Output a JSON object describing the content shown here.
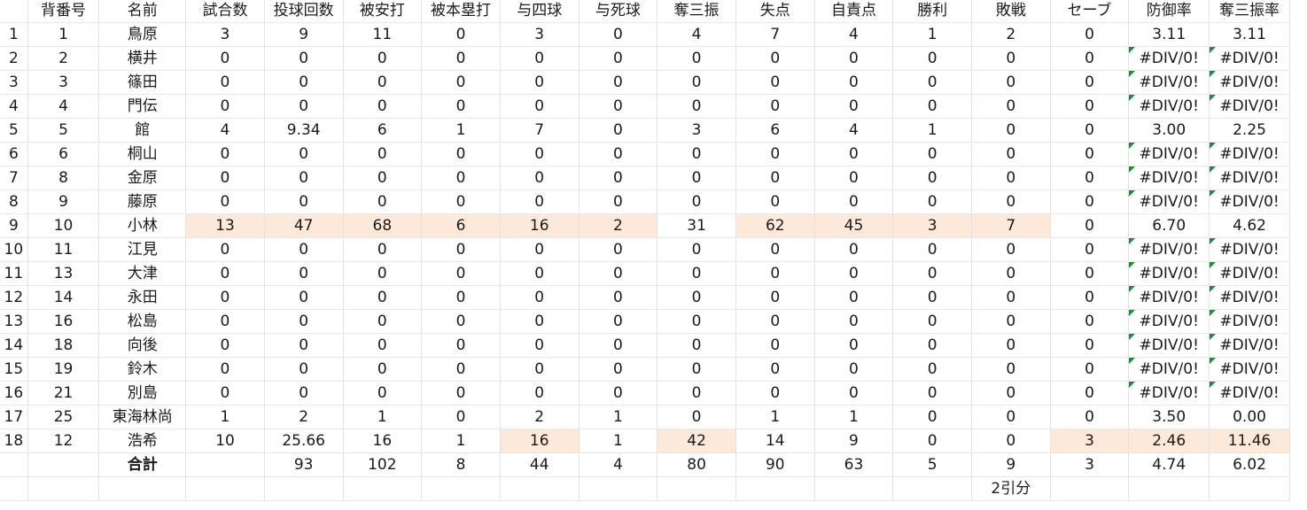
{
  "headers": [
    "",
    "背番号",
    "名前",
    "試合数",
    "投球回数",
    "被安打",
    "被本塁打",
    "与四球",
    "与死球",
    "奪三振",
    "失点",
    "自責点",
    "勝利",
    "敗戦",
    "セーブ",
    "防御率",
    "奪三振率"
  ],
  "rows": [
    [
      "1",
      "1",
      "鳥原",
      "3",
      "9",
      "11",
      "0",
      "3",
      "0",
      "4",
      "7",
      "4",
      "1",
      "2",
      "0",
      "3.11",
      "3.11"
    ],
    [
      "2",
      "2",
      "横井",
      "0",
      "0",
      "0",
      "0",
      "0",
      "0",
      "0",
      "0",
      "0",
      "0",
      "0",
      "0",
      "#DIV/0!",
      "#DIV/0!"
    ],
    [
      "3",
      "3",
      "篠田",
      "0",
      "0",
      "0",
      "0",
      "0",
      "0",
      "0",
      "0",
      "0",
      "0",
      "0",
      "0",
      "#DIV/0!",
      "#DIV/0!"
    ],
    [
      "4",
      "4",
      "門伝",
      "0",
      "0",
      "0",
      "0",
      "0",
      "0",
      "0",
      "0",
      "0",
      "0",
      "0",
      "0",
      "#DIV/0!",
      "#DIV/0!"
    ],
    [
      "5",
      "5",
      "館",
      "4",
      "9.34",
      "6",
      "1",
      "7",
      "0",
      "3",
      "6",
      "4",
      "1",
      "0",
      "0",
      "3.00",
      "2.25"
    ],
    [
      "6",
      "6",
      "桐山",
      "0",
      "0",
      "0",
      "0",
      "0",
      "0",
      "0",
      "0",
      "0",
      "0",
      "0",
      "0",
      "#DIV/0!",
      "#DIV/0!"
    ],
    [
      "7",
      "8",
      "金原",
      "0",
      "0",
      "0",
      "0",
      "0",
      "0",
      "0",
      "0",
      "0",
      "0",
      "0",
      "0",
      "#DIV/0!",
      "#DIV/0!"
    ],
    [
      "8",
      "9",
      "藤原",
      "0",
      "0",
      "0",
      "0",
      "0",
      "0",
      "0",
      "0",
      "0",
      "0",
      "0",
      "0",
      "#DIV/0!",
      "#DIV/0!"
    ],
    [
      "9",
      "10",
      "小林",
      "13",
      "47",
      "68",
      "6",
      "16",
      "2",
      "31",
      "62",
      "45",
      "3",
      "7",
      "0",
      "6.70",
      "4.62"
    ],
    [
      "10",
      "11",
      "江見",
      "0",
      "0",
      "0",
      "0",
      "0",
      "0",
      "0",
      "0",
      "0",
      "0",
      "0",
      "0",
      "#DIV/0!",
      "#DIV/0!"
    ],
    [
      "11",
      "13",
      "大津",
      "0",
      "0",
      "0",
      "0",
      "0",
      "0",
      "0",
      "0",
      "0",
      "0",
      "0",
      "0",
      "#DIV/0!",
      "#DIV/0!"
    ],
    [
      "12",
      "14",
      "永田",
      "0",
      "0",
      "0",
      "0",
      "0",
      "0",
      "0",
      "0",
      "0",
      "0",
      "0",
      "0",
      "#DIV/0!",
      "#DIV/0!"
    ],
    [
      "13",
      "16",
      "松島",
      "0",
      "0",
      "0",
      "0",
      "0",
      "0",
      "0",
      "0",
      "0",
      "0",
      "0",
      "0",
      "#DIV/0!",
      "#DIV/0!"
    ],
    [
      "14",
      "18",
      "向後",
      "0",
      "0",
      "0",
      "0",
      "0",
      "0",
      "0",
      "0",
      "0",
      "0",
      "0",
      "0",
      "#DIV/0!",
      "#DIV/0!"
    ],
    [
      "15",
      "19",
      "鈴木",
      "0",
      "0",
      "0",
      "0",
      "0",
      "0",
      "0",
      "0",
      "0",
      "0",
      "0",
      "0",
      "#DIV/0!",
      "#DIV/0!"
    ],
    [
      "16",
      "21",
      "別島",
      "0",
      "0",
      "0",
      "0",
      "0",
      "0",
      "0",
      "0",
      "0",
      "0",
      "0",
      "0",
      "#DIV/0!",
      "#DIV/0!"
    ],
    [
      "17",
      "25",
      "東海林尚",
      "1",
      "2",
      "1",
      "0",
      "2",
      "1",
      "0",
      "1",
      "1",
      "0",
      "0",
      "0",
      "3.50",
      "0.00"
    ],
    [
      "18",
      "12",
      "浩希",
      "10",
      "25.66",
      "16",
      "1",
      "16",
      "1",
      "42",
      "14",
      "9",
      "0",
      "0",
      "3",
      "2.46",
      "11.46"
    ]
  ],
  "highlighted": [
    [
      8,
      3
    ],
    [
      8,
      4
    ],
    [
      8,
      5
    ],
    [
      8,
      6
    ],
    [
      8,
      7
    ],
    [
      8,
      8
    ],
    [
      8,
      10
    ],
    [
      8,
      11
    ],
    [
      8,
      12
    ],
    [
      8,
      13
    ],
    [
      17,
      7
    ],
    [
      17,
      9
    ],
    [
      17,
      14
    ],
    [
      17,
      15
    ],
    [
      17,
      16
    ]
  ],
  "totals": [
    "",
    "",
    "合計",
    "",
    "93",
    "102",
    "8",
    "44",
    "4",
    "80",
    "90",
    "63",
    "5",
    "9",
    "3",
    "4.74",
    "6.02"
  ],
  "note_row": [
    "",
    "",
    "",
    "",
    "",
    "",
    "",
    "",
    "",
    "",
    "",
    "",
    "",
    "2引分",
    "",
    "",
    ""
  ],
  "colors": {
    "highlight": "#fde9d9",
    "error_triangle": "#1e8c3a",
    "grid": "#e2e2e2"
  }
}
